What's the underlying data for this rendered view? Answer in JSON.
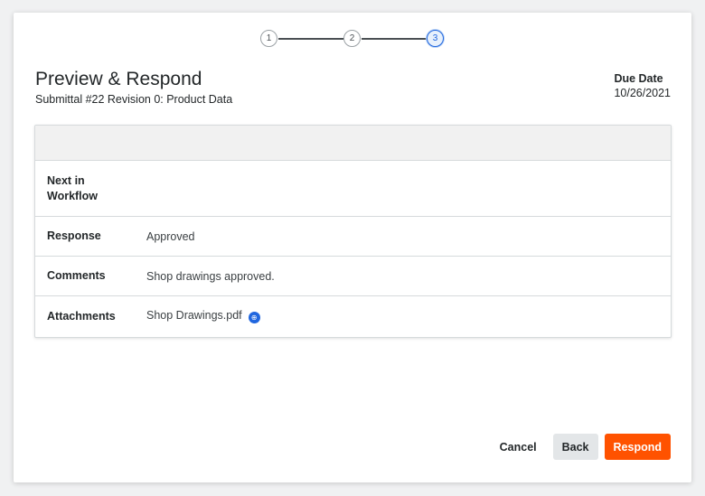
{
  "stepper": {
    "steps": [
      "1",
      "2",
      "3"
    ],
    "active_step": 3,
    "active_color": "#2066df"
  },
  "header": {
    "title": "Preview & Respond",
    "subtitle": "Submittal #22 Revision 0: Product Data",
    "due_date_label": "Due Date",
    "due_date_value": "10/26/2021"
  },
  "details": {
    "rows": [
      {
        "label": "Next in Workflow",
        "value": ""
      },
      {
        "label": "Response",
        "value": "Approved"
      },
      {
        "label": "Comments",
        "value": "Shop drawings approved."
      },
      {
        "label": "Attachments",
        "value": "Shop Drawings.pdf",
        "icon": "attachment-badge-icon"
      }
    ]
  },
  "footer": {
    "cancel_label": "Cancel",
    "back_label": "Back",
    "respond_label": "Respond",
    "respond_color": "#ff5200"
  }
}
